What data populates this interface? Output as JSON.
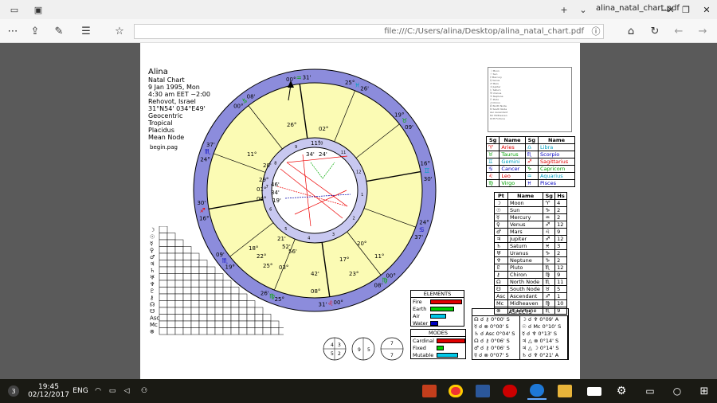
{
  "browser": {
    "tab_title": "alina_natal_chart.pdf",
    "url": "file:///C:/Users/alina/Desktop/alina_natal_chart.pdf",
    "icons": [
      "ellipsis-icon",
      "share-icon",
      "pen-icon",
      "favorites-icon",
      "star-icon",
      "info-icon",
      "home-icon",
      "refresh-icon",
      "back-icon",
      "forward-icon"
    ]
  },
  "chart": {
    "name": "Alina",
    "type": "Natal Chart",
    "date": "9 Jan 1995, Mon",
    "time": "4:30 am  EET −2:00",
    "place": "Rehovot, Israel",
    "coords": "31°N54' 034°E49'",
    "geo": "Geocentric",
    "zodiac": "Tropical",
    "houses": "Placidus",
    "node": "Mean Node",
    "page_note": "begin.pag"
  },
  "signs_table": {
    "header": [
      "Sg",
      "Name",
      "Sg",
      "Name"
    ],
    "rows": [
      [
        "♈",
        "Aries",
        "♎",
        "Libra"
      ],
      [
        "♉",
        "Taurus",
        "♏",
        "Scorpio"
      ],
      [
        "♊",
        "Gemini",
        "♐",
        "Sagittarius"
      ],
      [
        "♋",
        "Cancer",
        "♑",
        "Capricorn"
      ],
      [
        "♌",
        "Leo",
        "♒",
        "Aquarius"
      ],
      [
        "♍",
        "Virgo",
        "♓",
        "Pisces"
      ]
    ],
    "colors": [
      "#e00000",
      "#00a000",
      "#00a0c0",
      "#0000c0"
    ]
  },
  "planets_table": {
    "header": [
      "Pt",
      "Name",
      "Sg",
      "Hs"
    ],
    "rows": [
      [
        "☽",
        "Moon",
        "♈",
        "4"
      ],
      [
        "☉",
        "Sun",
        "♑",
        "2"
      ],
      [
        "☿",
        "Mercury",
        "♒",
        "2"
      ],
      [
        "♀",
        "Venus",
        "♐",
        "12"
      ],
      [
        "♂",
        "Mars",
        "♌",
        "9"
      ],
      [
        "♃",
        "Jupiter",
        "♐",
        "12"
      ],
      [
        "♄",
        "Saturn",
        "♓",
        "3"
      ],
      [
        "♅",
        "Uranus",
        "♑",
        "2"
      ],
      [
        "♆",
        "Neptune",
        "♑",
        "2"
      ],
      [
        "♇",
        "Pluto",
        "♏",
        "12"
      ],
      [
        "⚷",
        "Chiron",
        "♍",
        "9"
      ],
      [
        "☊",
        "North Node",
        "♏",
        "11"
      ],
      [
        "☋",
        "South Node",
        "♉",
        "5"
      ],
      [
        "Asc",
        "Ascendant",
        "♐",
        "1"
      ],
      [
        "Mc",
        "Midheaven",
        "♍",
        "10"
      ],
      [
        "⊗",
        "Pt Fortune",
        "♏",
        "9"
      ]
    ]
  },
  "elements": {
    "title": "ELEMENTS",
    "items": [
      {
        "label": "Fire",
        "value": 4,
        "color": "#e00000"
      },
      {
        "label": "Earth",
        "value": 3,
        "color": "#00cc00"
      },
      {
        "label": "Air",
        "value": 2,
        "color": "#00c8e8"
      },
      {
        "label": "Water",
        "value": 1,
        "color": "#0000c0"
      }
    ],
    "max": 4
  },
  "modes": {
    "title": "MODES",
    "items": [
      {
        "label": "Cardinal",
        "value": 4,
        "color": "#e00000"
      },
      {
        "label": "Fixed",
        "value": 1,
        "color": "#00cc00"
      },
      {
        "label": "Mutable",
        "value": 3,
        "color": "#00c8e8"
      }
    ],
    "max": 4
  },
  "aspects": {
    "title": "ASPECTS",
    "rows": [
      [
        "☊ ☌ ⚷ 0°00' S",
        "☽ ☌ ♆ 0°09' A"
      ],
      [
        "☿ ☌ ⊗ 0°00' S",
        "☉ ☌ Mc 0°10' S"
      ],
      [
        "♄ ☌ Asc 0°04' S",
        "☿ ☌ ♆ 0°13' S"
      ],
      [
        "☊ ☌ ⚷ 0°06' S",
        "♃ △ ⊗ 0°14' S"
      ],
      [
        "♂ ☌ ⚷ 0°06' S",
        "♃ △ ☽ 0°14' S"
      ],
      [
        "☿ ☌ ⊗ 0°07' S",
        "♄ ☌ ♆ 0°21' A"
      ]
    ]
  },
  "wheel": {
    "cusps": [
      {
        "deg": "00°",
        "min": "31'",
        "sign": "♒"
      },
      {
        "deg": "25°",
        "min": "26'",
        "sign": "♓"
      },
      {
        "deg": "19°",
        "min": "09'",
        "sign": "♉"
      },
      {
        "deg": "16°",
        "min": "30'",
        "sign": "♊"
      },
      {
        "deg": "24°",
        "min": "37'",
        "sign": "♋"
      },
      {
        "deg": "00°",
        "min": "08'",
        "sign": "♍"
      },
      {
        "deg": "00°",
        "min": "31'",
        "sign": "♌"
      },
      {
        "deg": "25°",
        "min": "26'",
        "sign": "♍"
      },
      {
        "deg": "19°",
        "min": "09'",
        "sign": "♏"
      },
      {
        "deg": "16°",
        "min": "30'",
        "sign": "♐"
      },
      {
        "deg": "24°",
        "min": "37'",
        "sign": "♏"
      },
      {
        "deg": "00°",
        "min": "08'",
        "sign": "♑"
      }
    ],
    "planet_labels": [
      "26°",
      "02°",
      "11°",
      "34'",
      "24'",
      "29°",
      "01°",
      "06°",
      "46'",
      "34'",
      "19'",
      "18°",
      "22°",
      "25°",
      "21'",
      "52'",
      "56'",
      "03°",
      "17°",
      "23°",
      "20°",
      "11°",
      "42'",
      "08°",
      "11°",
      "20'"
    ]
  },
  "mini_boxes": [
    "4",
    "3",
    "5",
    "2",
    "9",
    "5",
    "7",
    "7"
  ],
  "taskbar": {
    "time": "19:45",
    "date": "02/12/2017",
    "lang": "ENG",
    "badge": "3"
  }
}
